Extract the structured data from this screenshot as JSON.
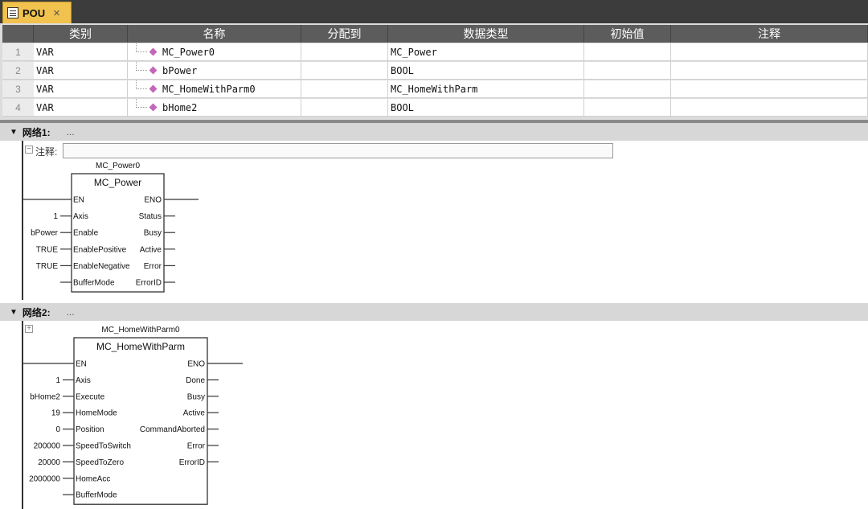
{
  "tab": {
    "title": "POU",
    "close": "×",
    "icon": "pou-icon"
  },
  "vars": {
    "headers": [
      "类别",
      "名称",
      "分配到",
      "数据类型",
      "初始值",
      "注释"
    ],
    "rows": [
      {
        "num": "1",
        "category": "VAR",
        "name": "MC_Power0",
        "assign": "",
        "type": "MC_Power",
        "init": "",
        "comment": ""
      },
      {
        "num": "2",
        "category": "VAR",
        "name": "bPower",
        "assign": "",
        "type": "BOOL",
        "init": "",
        "comment": ""
      },
      {
        "num": "3",
        "category": "VAR",
        "name": "MC_HomeWithParm0",
        "assign": "",
        "type": "MC_HomeWithParm",
        "init": "",
        "comment": ""
      },
      {
        "num": "4",
        "category": "VAR",
        "name": "bHome2",
        "assign": "",
        "type": "BOOL",
        "init": "",
        "comment": ""
      }
    ]
  },
  "networks": [
    {
      "title": "网络1:",
      "ellipsis": "...",
      "comment_label": "注释:",
      "comment_value": "",
      "block": {
        "instance": "MC_Power0",
        "type": "MC_Power",
        "inputs": [
          {
            "pin": "EN",
            "value": ""
          },
          {
            "pin": "Axis",
            "value": "1"
          },
          {
            "pin": "Enable",
            "value": "bPower"
          },
          {
            "pin": "EnablePositive",
            "value": "TRUE"
          },
          {
            "pin": "EnableNegative",
            "value": "TRUE"
          },
          {
            "pin": "BufferMode",
            "value": ""
          }
        ],
        "outputs": [
          "ENO",
          "Status",
          "Busy",
          "Active",
          "Error",
          "ErrorID"
        ]
      }
    },
    {
      "title": "网络2:",
      "ellipsis": "...",
      "block": {
        "instance": "MC_HomeWithParm0",
        "type": "MC_HomeWithParm",
        "inputs": [
          {
            "pin": "EN",
            "value": ""
          },
          {
            "pin": "Axis",
            "value": "1"
          },
          {
            "pin": "Execute",
            "value": "bHome2"
          },
          {
            "pin": "HomeMode",
            "value": "19"
          },
          {
            "pin": "Position",
            "value": "0"
          },
          {
            "pin": "SpeedToSwitch",
            "value": "200000"
          },
          {
            "pin": "SpeedToZero",
            "value": "20000"
          },
          {
            "pin": "HomeAcc",
            "value": "2000000"
          },
          {
            "pin": "BufferMode",
            "value": ""
          }
        ],
        "outputs": [
          "ENO",
          "Done",
          "Busy",
          "Active",
          "CommandAborted",
          "Error",
          "ErrorID"
        ]
      }
    }
  ]
}
